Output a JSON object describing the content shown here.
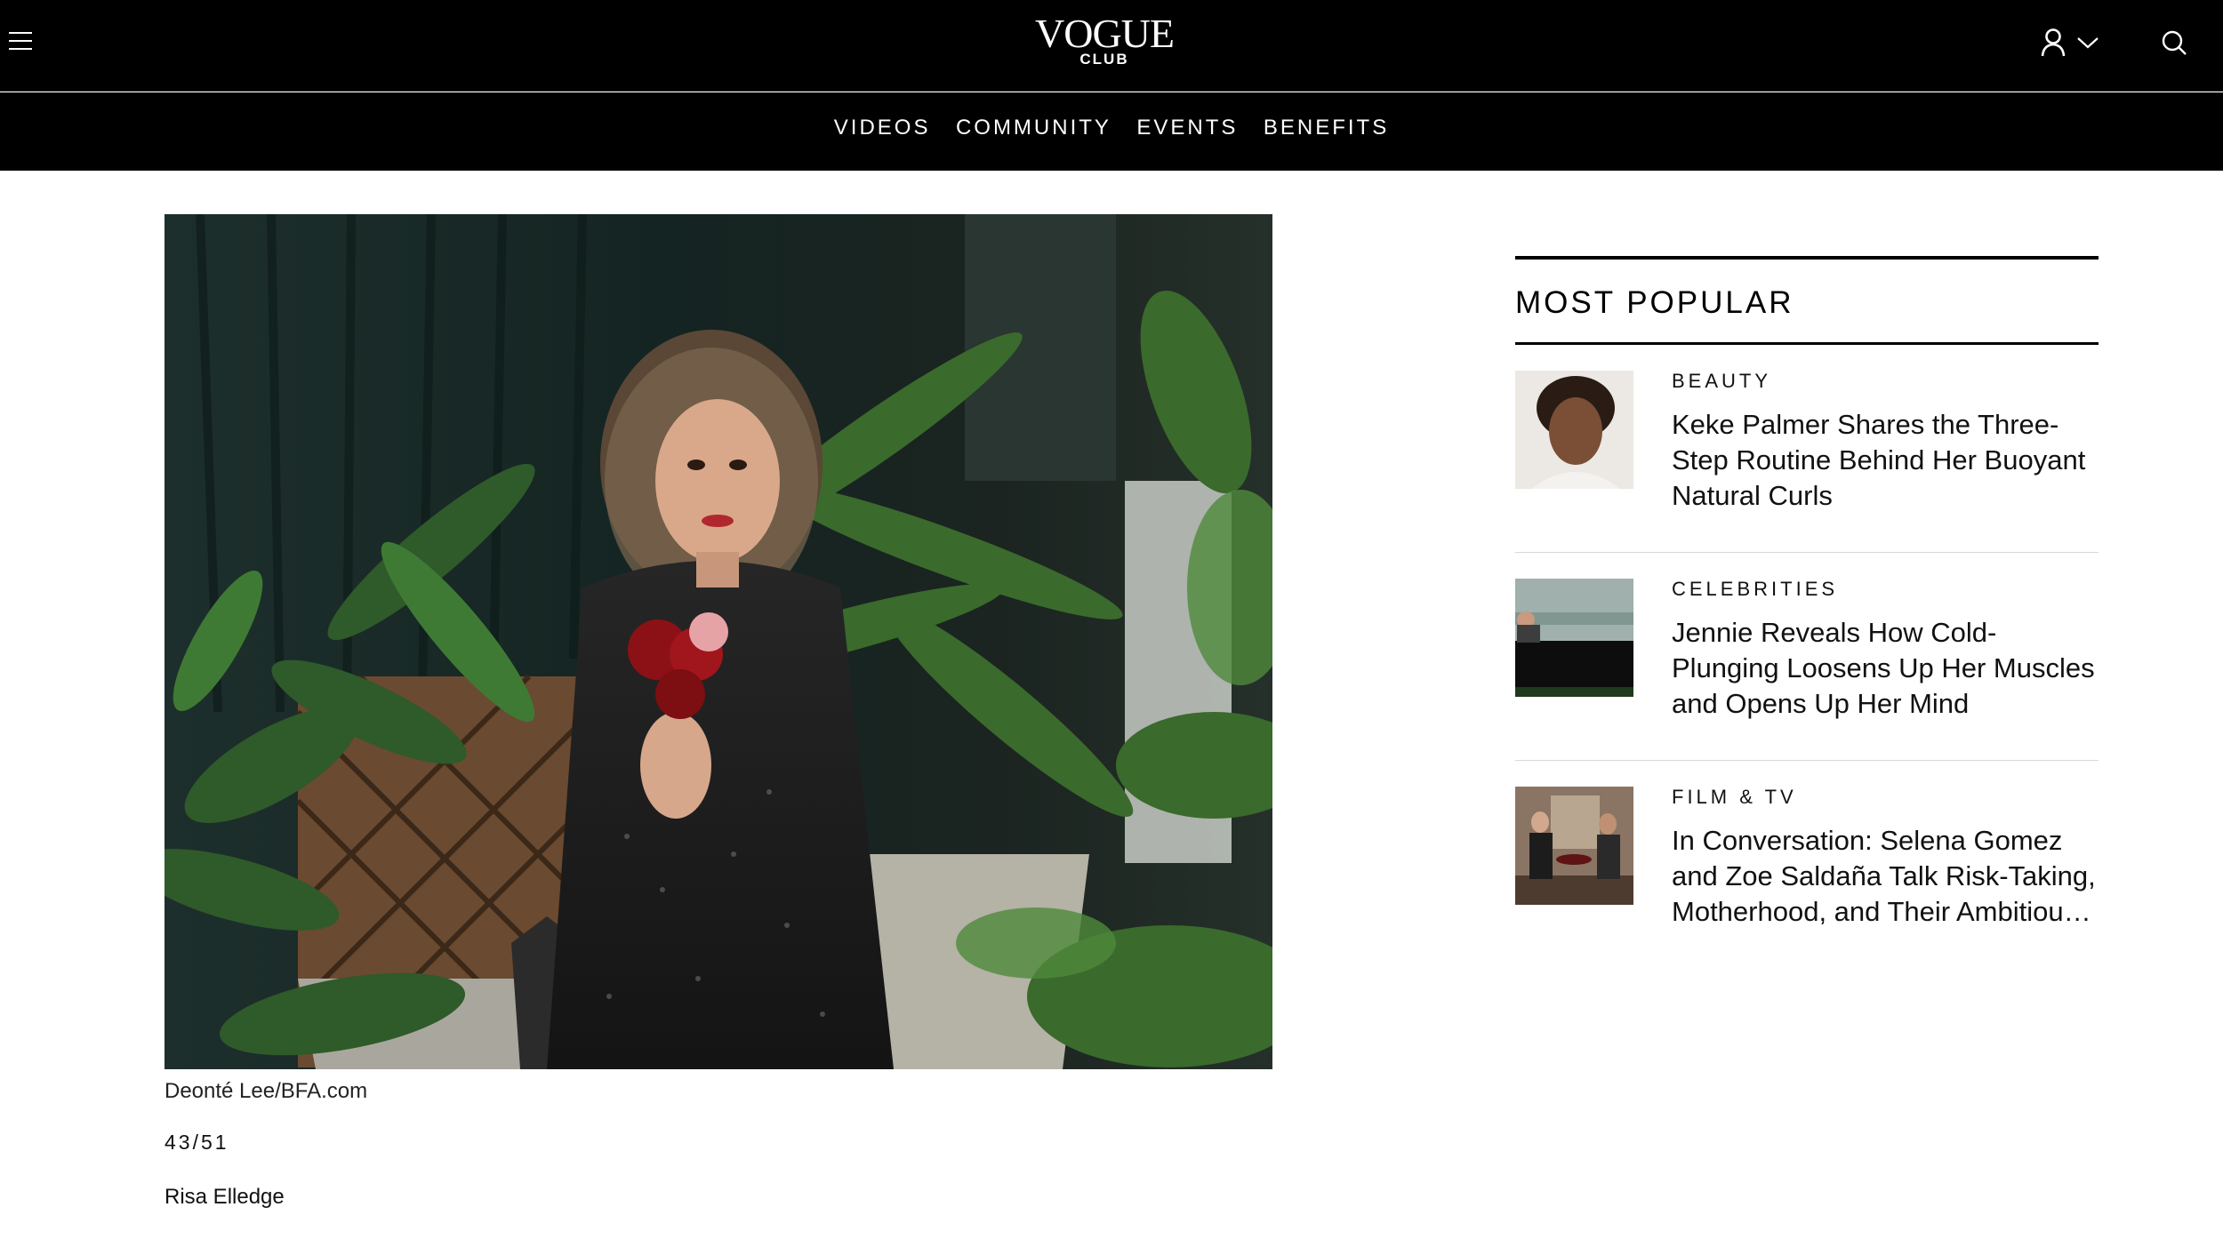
{
  "header": {
    "logo_main": "VOGUE",
    "logo_sub": "CLUB"
  },
  "nav": {
    "items": [
      {
        "label": "VIDEOS"
      },
      {
        "label": "COMMUNITY"
      },
      {
        "label": "EVENTS"
      },
      {
        "label": "BENEFITS"
      }
    ]
  },
  "gallery": {
    "credit": "Deonté Lee/BFA.com",
    "counter": "43/51",
    "caption": "Risa Elledge"
  },
  "sidebar": {
    "heading": "MOST POPULAR",
    "stories": [
      {
        "category": "BEAUTY",
        "title": "Keke Palmer Shares the Three-Step Routine Behind Her Buoyant Natural Curls"
      },
      {
        "category": "CELEBRITIES",
        "title": "Jennie Reveals How Cold-Plunging Loosens Up Her Muscles and Opens Up Her Mind"
      },
      {
        "category": "FILM & TV",
        "title": "In Conversation: Selena Gomez and Zoe Saldaña Talk Risk-Taking, Motherhood, and Their Ambitiou…"
      }
    ]
  },
  "icons": {
    "menu": "hamburger-menu-icon",
    "account": "user-icon",
    "dropdown": "chevron-down-icon",
    "search": "search-icon"
  },
  "colors": {
    "header_bg": "#000000",
    "header_text": "#ffffff",
    "page_bg": "#ffffff"
  }
}
